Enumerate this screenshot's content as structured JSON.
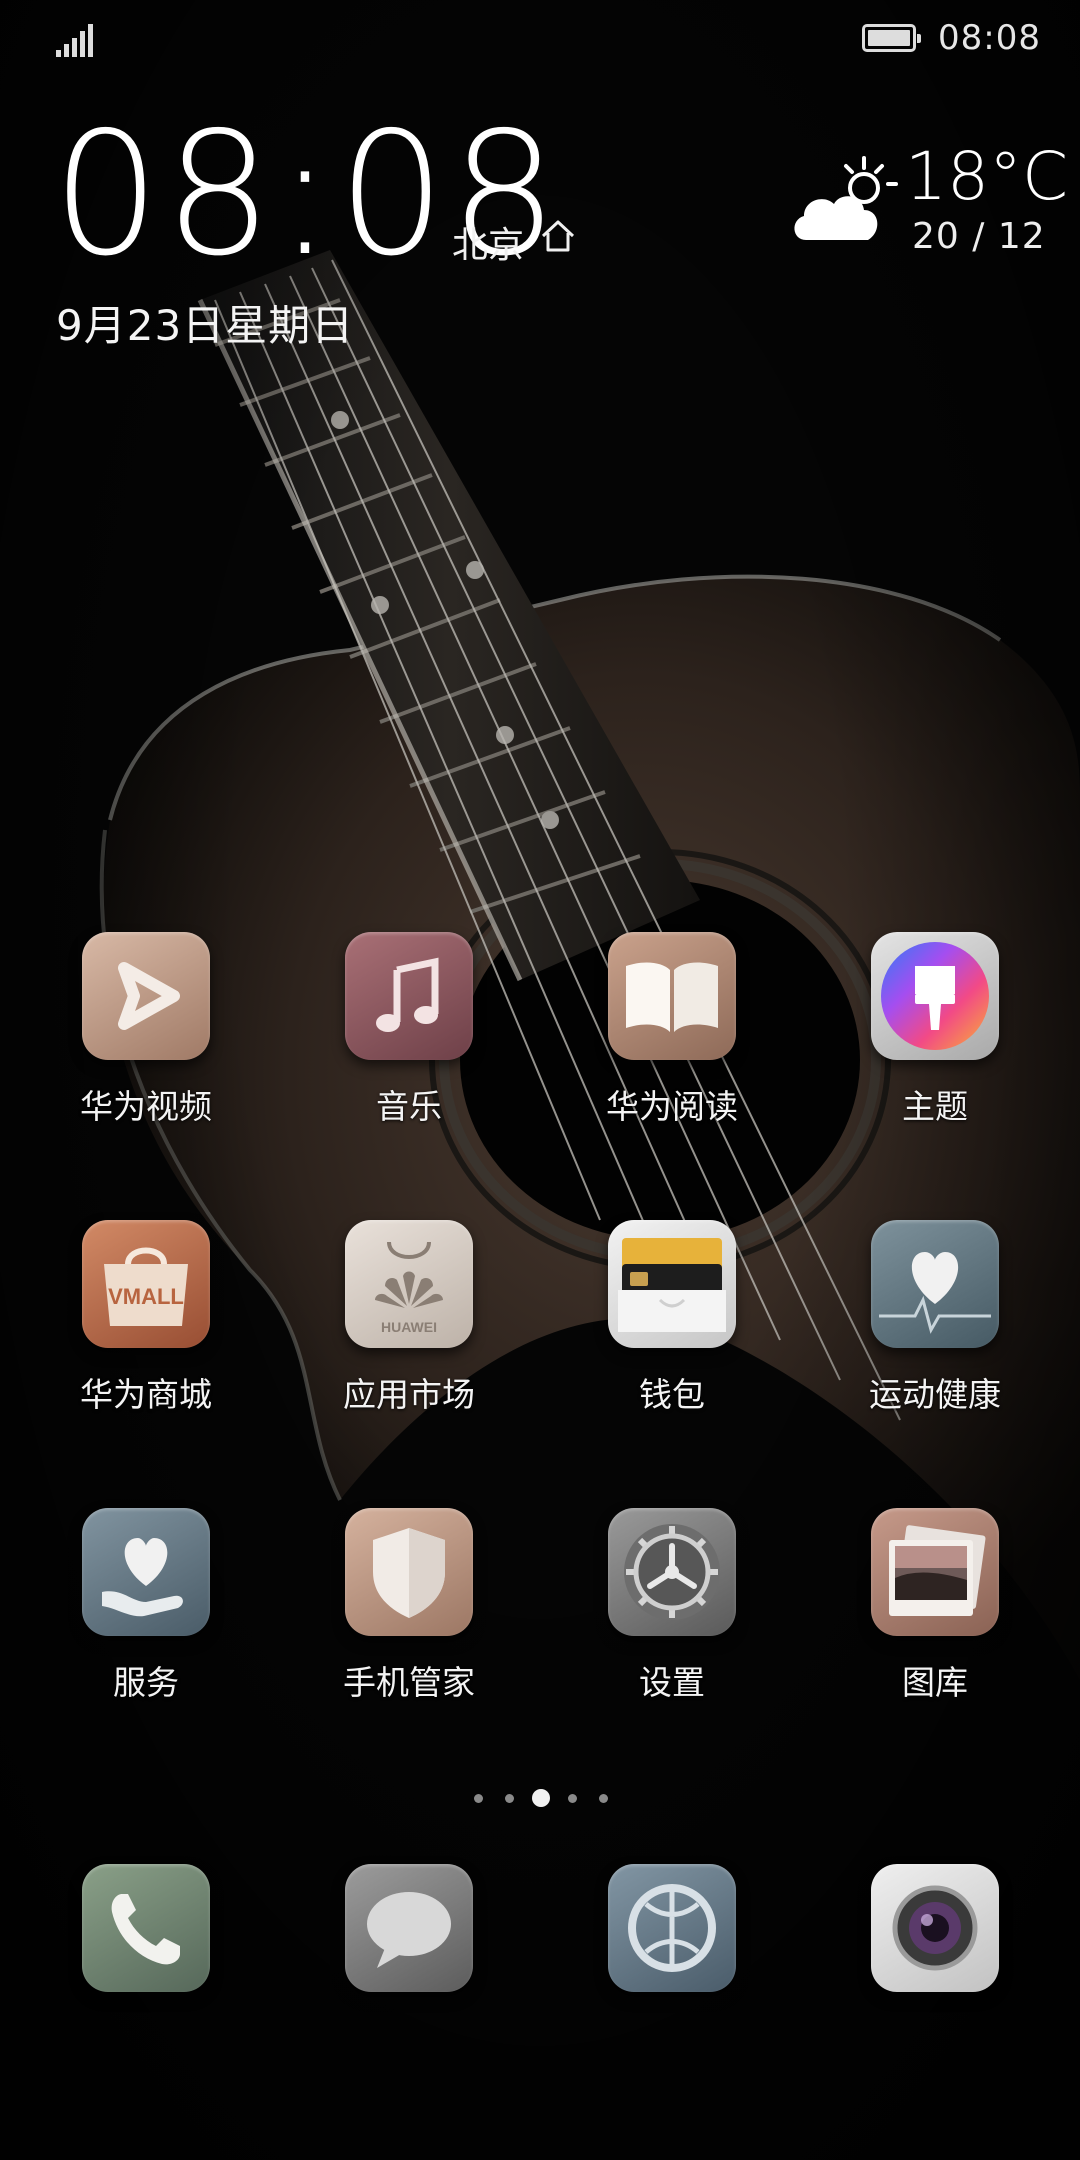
{
  "status_bar": {
    "time": "08:08",
    "signal_icon": "signal-bars-icon",
    "battery_icon": "battery-icon"
  },
  "clock": {
    "time": "08:08",
    "city": "北京",
    "date": "9月23日星期日"
  },
  "weather": {
    "temp": "18°C",
    "range": "20 / 12",
    "icon": "partly-cloudy-icon"
  },
  "apps": [
    {
      "label": "华为视频"
    },
    {
      "label": "音乐"
    },
    {
      "label": "华为阅读"
    },
    {
      "label": "主题"
    },
    {
      "label": "华为商城",
      "icon_text": "VMALL"
    },
    {
      "label": "应用市场",
      "icon_text": "HUAWEI"
    },
    {
      "label": "钱包"
    },
    {
      "label": "运动健康"
    },
    {
      "label": "服务"
    },
    {
      "label": "手机管家"
    },
    {
      "label": "设置"
    },
    {
      "label": "图库"
    }
  ],
  "pager": {
    "count": 5,
    "active": 3
  },
  "dock": [
    {
      "icon": "phone-icon"
    },
    {
      "icon": "messages-icon"
    },
    {
      "icon": "browser-icon"
    },
    {
      "icon": "camera-icon"
    }
  ]
}
